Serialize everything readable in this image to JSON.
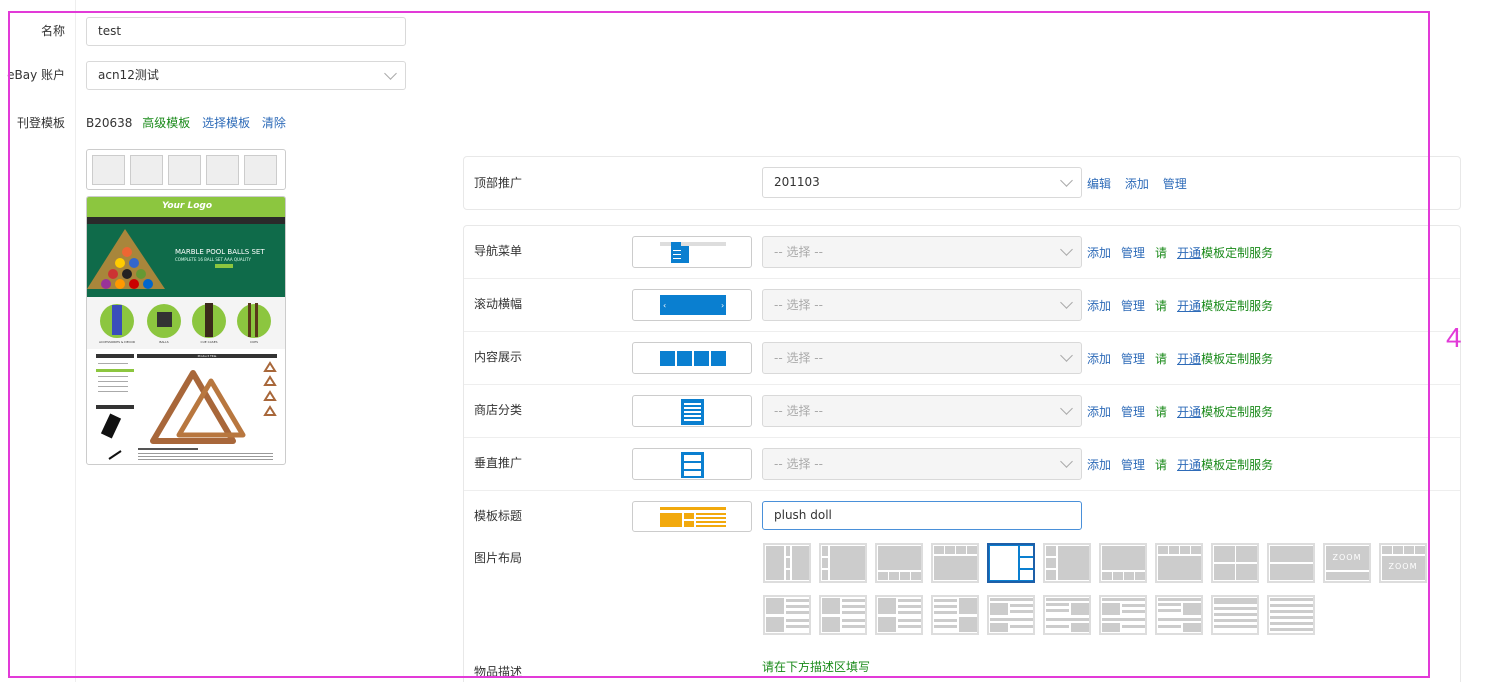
{
  "form": {
    "name_label": "名称",
    "name_value": "test",
    "account_label": "eBay 账户",
    "account_value": "acn12测试",
    "template_label": "刊登模板",
    "template_code": "B20638",
    "advanced_template": "高级模板",
    "choose_template": "选择模板",
    "clear": "清除"
  },
  "preview": {
    "logo": "Your Logo",
    "banner_title": "MARBLE POOL BALLS SET",
    "banner_sub": "COMPLETE 16 BALL SET AAA QUALITY",
    "categories": [
      "ACCESSORIES & DECOR",
      "BALLS",
      "CUE CASES",
      "CUES"
    ],
    "product_title": "Product Title"
  },
  "top_promo": {
    "label": "顶部推广",
    "value": "201103",
    "edit": "编辑",
    "add": "添加",
    "manage": "管理"
  },
  "modules": [
    {
      "label": "导航菜单",
      "placeholder": "-- 选择 --"
    },
    {
      "label": "滚动横幅",
      "placeholder": "-- 选择 --"
    },
    {
      "label": "内容展示",
      "placeholder": "-- 选择 --"
    },
    {
      "label": "商店分类",
      "placeholder": "-- 选择 --"
    },
    {
      "label": "垂直推广",
      "placeholder": "-- 选择 --"
    }
  ],
  "module_actions": {
    "add": "添加",
    "manage": "管理",
    "svc_prefix": "请",
    "svc_link": "开通",
    "svc_suffix": "模板定制服务"
  },
  "title_row": {
    "label": "模板标题",
    "value": "plush doll"
  },
  "image_layout": {
    "label": "图片布局",
    "zoom": "ZOOM",
    "selected_index": 4
  },
  "description": {
    "label": "物品描述",
    "hint": "请在下方描述区填写"
  },
  "annotation": {
    "number": "4"
  },
  "colors": {
    "accent_blue": "#0a7fd0",
    "link_blue": "#2e6bb8",
    "link_green": "#1a8a1a",
    "frame": "#e23ad8"
  }
}
